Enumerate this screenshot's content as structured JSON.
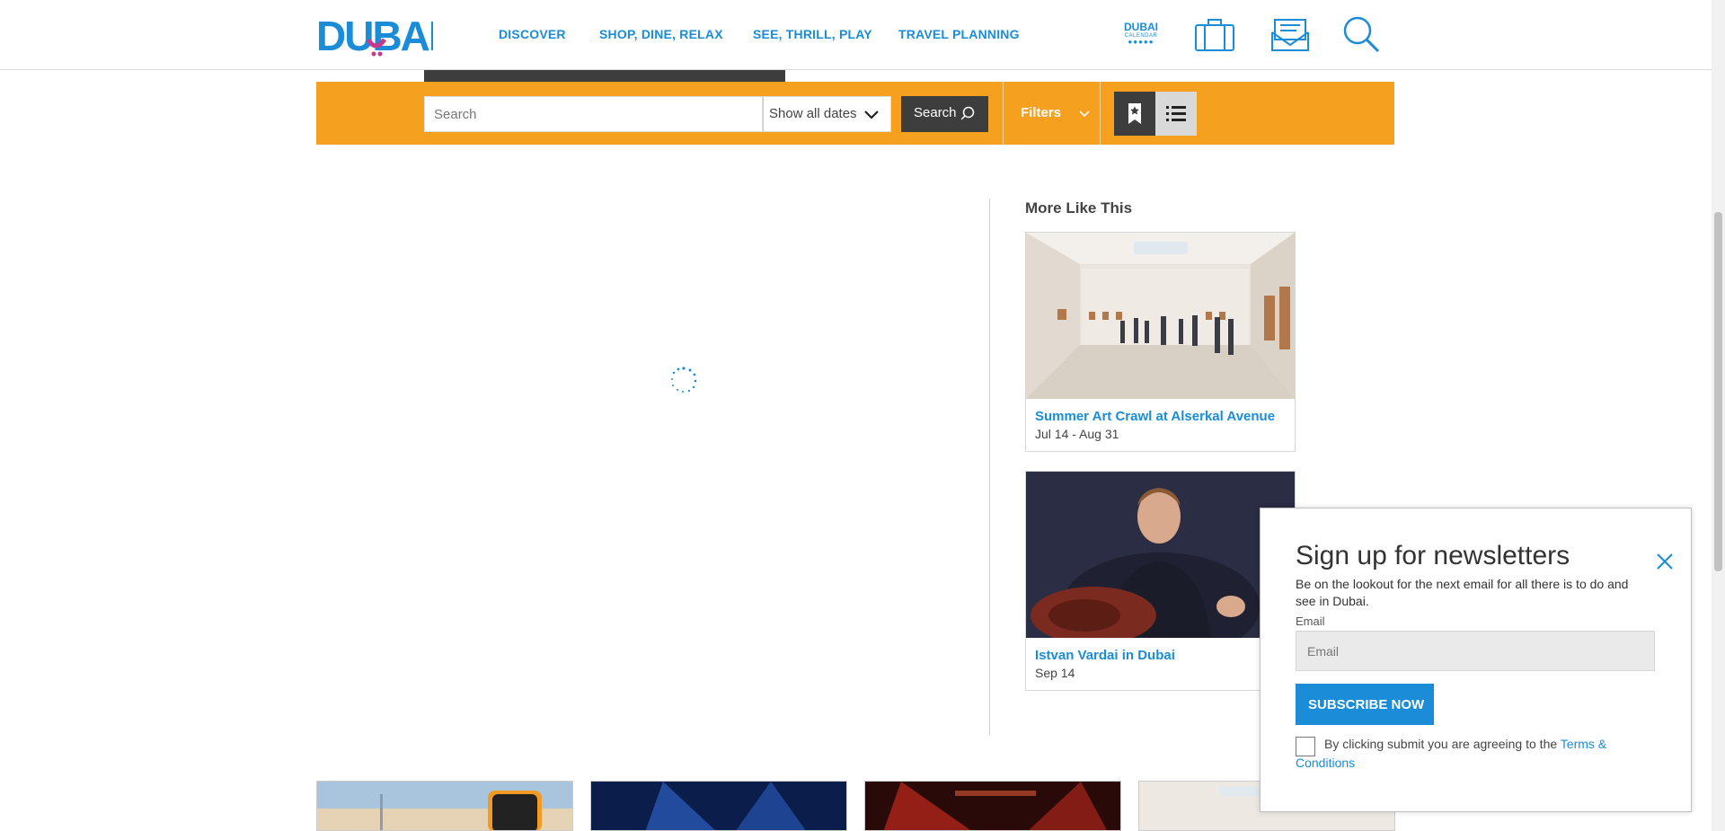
{
  "brand": {
    "name": "DUBAI",
    "accent": "#1a8cd8",
    "orange": "#f5a01f",
    "dark": "#3d3d3d"
  },
  "nav": {
    "items": [
      "DISCOVER",
      "SHOP, DINE, RELAX",
      "SEE, THRILL, PLAY",
      "TRAVEL PLANNING"
    ],
    "calendar_logo": {
      "line1": "DUBAI",
      "line2": "CALENDAR",
      "dots": "●●●●●"
    },
    "icons": [
      "suitcase-icon",
      "newsletter-icon",
      "search-icon"
    ]
  },
  "searchbar": {
    "placeholder": "Search",
    "date_filter": "Show all dates",
    "search_button": "Search",
    "filters_button": "Filters"
  },
  "sidebar": {
    "title": "More Like This",
    "cards": [
      {
        "title": "Summer Art Crawl at Alserkal Avenue",
        "date": "Jul 14 - Aug 31"
      },
      {
        "title": "Istvan Vardai in Dubai",
        "date": "Sep 14"
      }
    ]
  },
  "newsletter": {
    "heading": "Sign up for newsletters",
    "description": "Be on the lookout for the next email for all there is to do and see in Dubai.",
    "email_label": "Email",
    "email_placeholder": "Email",
    "subscribe_button": "SUBSCRIBE NOW",
    "terms_text": "By clicking submit you are agreeing to the ",
    "terms_link": "Terms & Conditions"
  }
}
